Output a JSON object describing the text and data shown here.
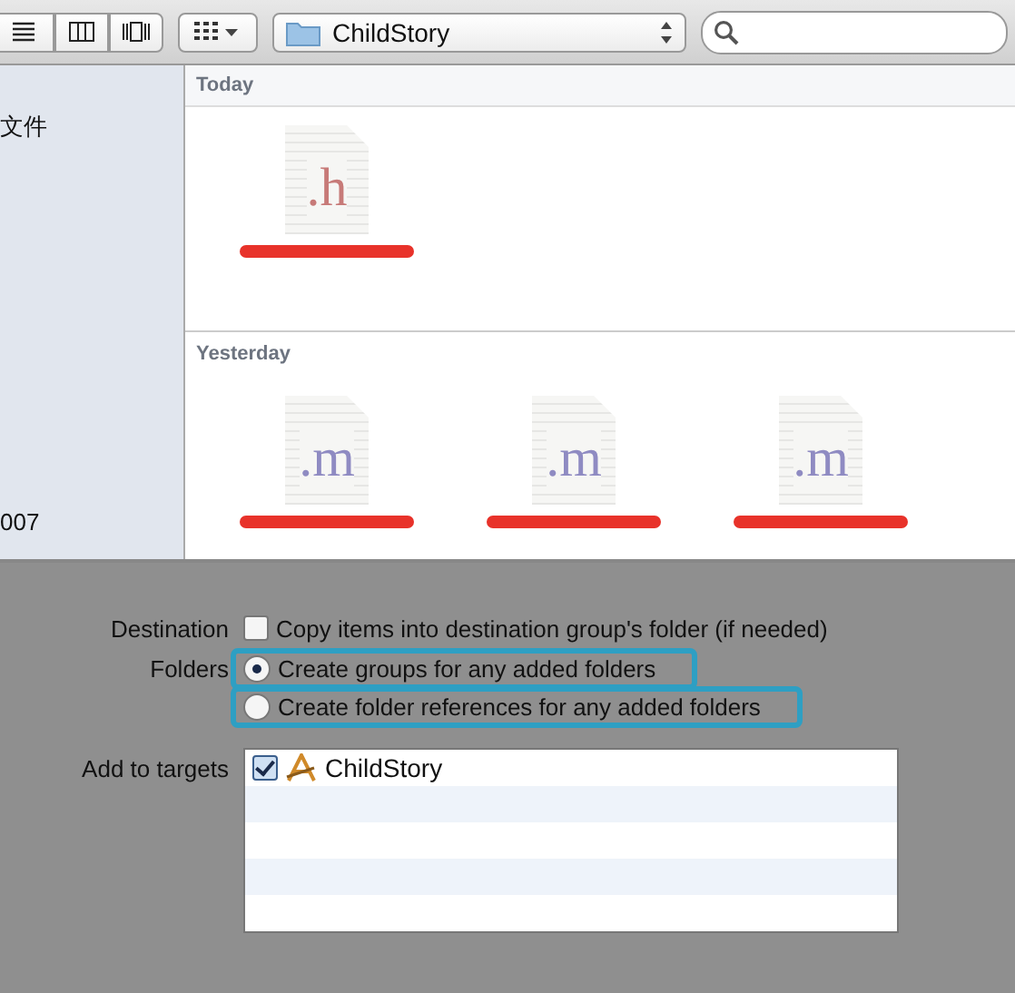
{
  "toolbar": {
    "view_buttons": [
      {
        "kind": "list"
      },
      {
        "kind": "columns"
      },
      {
        "kind": "coverflow"
      }
    ],
    "arrange_button": {
      "kind": "grid"
    },
    "path_popup": {
      "label": "ChildStory"
    }
  },
  "sidebar": {
    "items": [
      {
        "label": "文件"
      },
      {
        "label": "007"
      }
    ]
  },
  "sections": [
    {
      "title": "Today",
      "files": [
        {
          "ext": ".h",
          "kind": "h",
          "redacted": true
        }
      ]
    },
    {
      "title": "Yesterday",
      "files": [
        {
          "ext": ".m",
          "kind": "m",
          "redacted": true
        },
        {
          "ext": ".m",
          "kind": "m",
          "redacted": true
        },
        {
          "ext": ".m",
          "kind": "m",
          "redacted": true
        }
      ]
    }
  ],
  "options": {
    "destination": {
      "label": "Destination",
      "checkbox": {
        "label": "Copy items into destination group's folder (if needed)",
        "checked": false
      }
    },
    "folders": {
      "label": "Folders",
      "radios": [
        {
          "label": "Create groups for any added folders",
          "selected": true,
          "highlighted": true
        },
        {
          "label": "Create folder references for any added folders",
          "selected": false,
          "highlighted": true
        }
      ]
    },
    "targets": {
      "label": "Add to targets",
      "rows": [
        {
          "name": "ChildStory",
          "checked": true
        }
      ]
    }
  }
}
